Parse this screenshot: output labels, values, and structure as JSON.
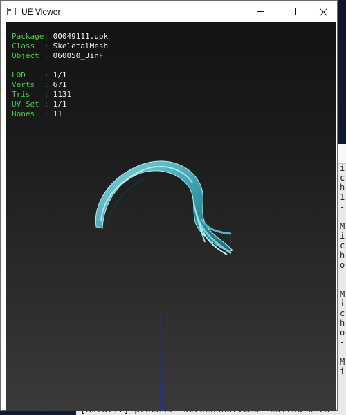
{
  "window": {
    "title": "UE Viewer",
    "buttons": {
      "minimize": "minimize-icon",
      "maximize": "maximize-icon",
      "close": "close-icon"
    }
  },
  "info": {
    "package": {
      "label": "Package: ",
      "value": "00049111.upk"
    },
    "class": {
      "label": "Class  : ",
      "value": "SkeletalMesh"
    },
    "object": {
      "label": "Object : ",
      "value": "060050_JinF"
    },
    "lod": {
      "label": "LOD    : ",
      "value": "1/1"
    },
    "verts": {
      "label": "Verts  : ",
      "value": "671"
    },
    "tris": {
      "label": "Tris   : ",
      "value": "1131"
    },
    "uvset": {
      "label": "UV Set : ",
      "value": "1/1"
    },
    "bones": {
      "label": "Bones  : ",
      "value": "11"
    }
  },
  "desktop": {
    "stray_char": "M"
  },
  "console": {
    "lines": "i\nc\nh\n1\n-\n\nM\ni\nc\nh\no\n-\n\nM\ni\nc\nh\no\n-\n\nM\ni",
    "bottom_text": "[RstUtil] process \"screenshot.cmd\" exited with"
  },
  "colors": {
    "label": "#3fd23f",
    "value": "#f2f2f2",
    "mesh": "#5fc4cc",
    "axis": "#1a2ad0"
  }
}
